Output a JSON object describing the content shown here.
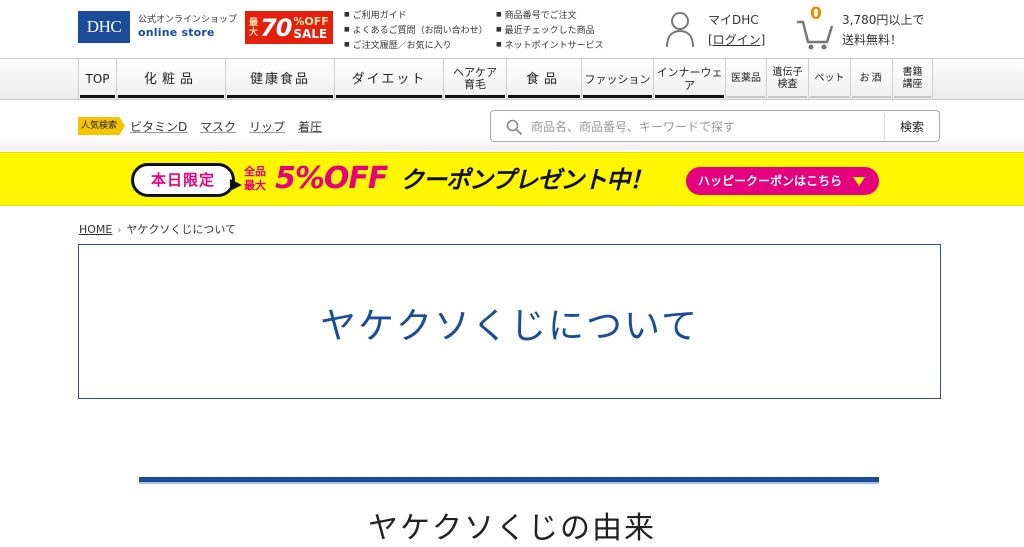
{
  "header": {
    "logo": "DHC",
    "store_jp": "公式オンラインショップ",
    "store_en": "online store",
    "sale_badge": {
      "prefix": "最大",
      "percent": "70",
      "off": "%OFF",
      "sale": "SALE"
    },
    "guide_links_col1": [
      "ご利用ガイド",
      "よくあるご質問（お問い合わせ）",
      "ご注文履歴／お気に入り"
    ],
    "guide_links_col2": [
      "商品番号でご注文",
      "最近チェックした商品",
      "ネットポイントサービス"
    ],
    "my_label": "マイDHC",
    "login_label": "[ログイン]",
    "cart_count": "0",
    "free_shipping_line1": "3,780円以上で",
    "free_shipping_line2": "送料無料！"
  },
  "nav": {
    "items": [
      {
        "label": "TOP"
      },
      {
        "label": "化粧品"
      },
      {
        "label": "健康食品"
      },
      {
        "label": "ダイエット"
      },
      {
        "label": "ヘアケア\n育毛"
      },
      {
        "label": "食品"
      },
      {
        "label": "ファッション"
      },
      {
        "label": "インナーウェア"
      },
      {
        "label": "医薬品"
      },
      {
        "label": "遺伝子\n検査"
      },
      {
        "label": "ペット"
      },
      {
        "label": "お酒"
      },
      {
        "label": "書籍\n講座"
      }
    ]
  },
  "search": {
    "popular_label": "人気検索",
    "keywords": [
      "ビタミンD",
      "マスク",
      "リップ",
      "着圧"
    ],
    "placeholder": "商品名、商品番号、キーワードで探す",
    "value": "",
    "button_label": "検索"
  },
  "banner": {
    "bubble": "本日限定",
    "all_items": "全品",
    "max": "最大",
    "promo": "5%OFF",
    "promo_rest": "クーポンプレゼント中！",
    "coupon_button": "ハッピークーポンはこちら",
    "colors": {
      "background": "#fff700",
      "accent": "#e5007f"
    }
  },
  "breadcrumb": {
    "home": "HOME",
    "separator": "›",
    "current": "ヤケクソくじについて"
  },
  "main": {
    "page_title": "ヤケクソくじについて",
    "section_title": "ヤケクソくじの由来"
  },
  "colors": {
    "brand_blue": "#1a4c9a",
    "sale_red": "#e4200c",
    "cart_orange": "#f08c00"
  }
}
